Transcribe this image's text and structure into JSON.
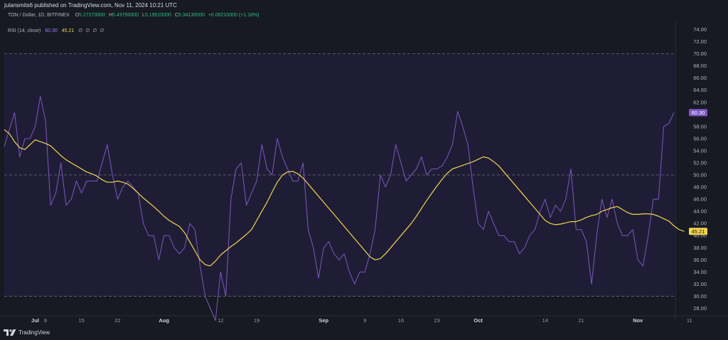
{
  "header": {
    "published": "julansmits6 published on TradingView.com, Nov 11, 2024 10:21 UTC",
    "symbol": "TON / Dollar, 1D, BITFINEX",
    "o_label": "O",
    "o_value": "5.27270000",
    "h_label": "H",
    "h_value": "5.43790000",
    "l_label": "L",
    "l_value": "5.19510000",
    "c_label": "C",
    "c_value": "5.34130000",
    "change": "+0.06210000 (+1.18%)"
  },
  "indicator": {
    "name": "RSI (14, close)",
    "rsi_value": "60.30",
    "ma_value": "45.21",
    "extras": [
      "∅",
      "∅",
      "∅",
      "∅"
    ]
  },
  "footer": {
    "logo_text": "TradingView"
  },
  "colors": {
    "background": "#171a22",
    "band": "#1f1d35",
    "rsi_line": "#7e57c2",
    "ma_line": "#f1d44f",
    "rsi_badge": "#7e57c2",
    "ma_badge": "#f1d44f"
  },
  "chart_data": {
    "type": "line",
    "title": "",
    "xlabel": "",
    "ylabel": "",
    "ylim": [
      27,
      75
    ],
    "yticks": [
      28,
      30,
      32,
      34,
      36,
      38,
      40,
      42,
      44,
      46,
      48,
      50,
      52,
      54,
      56,
      58,
      60,
      62,
      64,
      66,
      68,
      70,
      72,
      74
    ],
    "ytick_labels": [
      "28.00",
      "30.00",
      "32.00",
      "34.00",
      "36.00",
      "38.00",
      "40.00",
      "42.00",
      "44.00",
      "46.00",
      "48.00",
      "50.00",
      "52.00",
      "54.00",
      "56.00",
      "58.00",
      "60.00",
      "62.00",
      "64.00",
      "66.00",
      "68.00",
      "70.00",
      "72.00",
      "74.00"
    ],
    "reference_levels": [
      70,
      50,
      30
    ],
    "band": [
      30,
      70
    ],
    "xticks": [
      {
        "label": "Jul",
        "day": 6,
        "bold": true
      },
      {
        "label": "8",
        "day": 8,
        "bold": false
      },
      {
        "label": "15",
        "day": 15,
        "bold": false
      },
      {
        "label": "22",
        "day": 22,
        "bold": false
      },
      {
        "label": "Aug",
        "day": 31,
        "bold": true
      },
      {
        "label": "12",
        "day": 42,
        "bold": false
      },
      {
        "label": "19",
        "day": 49,
        "bold": false
      },
      {
        "label": "Sep",
        "day": 62,
        "bold": true
      },
      {
        "label": "9",
        "day": 70,
        "bold": false
      },
      {
        "label": "16",
        "day": 77,
        "bold": false
      },
      {
        "label": "23",
        "day": 84,
        "bold": false
      },
      {
        "label": "Oct",
        "day": 92,
        "bold": true
      },
      {
        "label": "14",
        "day": 105,
        "bold": false
      },
      {
        "label": "21",
        "day": 112,
        "bold": false
      },
      {
        "label": "Nov",
        "day": 123,
        "bold": true
      },
      {
        "label": "11",
        "day": 133,
        "bold": false
      }
    ],
    "series": [
      {
        "name": "RSI",
        "values": [
          54.7,
          57.5,
          60.3,
          53,
          56,
          56,
          58,
          63,
          59,
          45,
          47,
          52,
          45,
          46,
          49,
          47,
          49,
          49,
          49,
          52,
          55,
          50,
          46,
          48,
          49,
          48,
          47,
          42,
          40,
          40,
          36,
          40,
          40,
          38,
          37,
          38,
          42,
          41,
          35,
          30,
          28,
          26,
          34,
          30,
          46,
          51,
          52,
          45,
          47,
          49,
          55,
          51,
          50,
          56,
          53,
          51,
          49,
          49,
          52,
          41,
          38,
          33,
          38,
          39,
          37,
          36,
          37,
          34,
          32,
          34,
          34,
          37,
          41,
          50,
          48,
          50,
          55,
          52,
          49,
          50,
          51,
          53,
          50,
          51,
          51,
          51.5,
          53,
          55,
          60.5,
          58,
          55,
          48,
          42,
          41,
          44,
          42,
          40,
          40,
          39,
          39,
          37,
          38,
          40,
          41,
          44,
          46,
          43,
          45,
          44,
          46,
          51,
          41,
          41,
          39,
          32,
          40,
          46,
          43,
          46,
          42,
          40,
          40,
          41,
          36,
          35,
          40,
          46,
          46,
          58,
          58.5,
          60.3
        ],
        "last_label": "60.30"
      },
      {
        "name": "RSI-based MA",
        "values": [
          57.5,
          56.8,
          55.5,
          54.5,
          54.2,
          55.0,
          55.8,
          55.5,
          55.2,
          54.8,
          54.0,
          53.2,
          52.5,
          52.0,
          51.5,
          51.0,
          50.5,
          50.2,
          49.8,
          49.2,
          48.8,
          48.8,
          49.0,
          48.8,
          48.5,
          47.8,
          47.0,
          46.2,
          45.5,
          44.8,
          44.0,
          43.2,
          42.5,
          42.0,
          41.5,
          40.5,
          39.0,
          37.5,
          36.0,
          35.2,
          35.0,
          35.8,
          36.8,
          37.5,
          38.2,
          38.8,
          39.5,
          40.2,
          41.0,
          42.5,
          44.0,
          45.5,
          47.2,
          48.8,
          50.0,
          50.5,
          50.6,
          50.2,
          49.5,
          48.5,
          47.5,
          46.5,
          45.5,
          44.5,
          43.5,
          42.5,
          41.5,
          40.5,
          39.5,
          38.5,
          37.5,
          36.5,
          36.0,
          36.2,
          37.0,
          38.0,
          39.0,
          40.0,
          41.0,
          42.0,
          43.2,
          44.5,
          45.8,
          47.0,
          48.2,
          49.3,
          50.3,
          51.0,
          51.3,
          51.6,
          51.9,
          52.2,
          52.6,
          53.0,
          52.8,
          52.2,
          51.5,
          50.5,
          49.5,
          48.5,
          47.5,
          46.5,
          45.5,
          44.5,
          43.5,
          42.5,
          42.0,
          41.8,
          41.9,
          42.1,
          42.3,
          42.3,
          42.6,
          43.0,
          43.3,
          43.5,
          44.0,
          44.3,
          44.6,
          44.8,
          44.3,
          43.8,
          43.5,
          43.5,
          43.6,
          43.6,
          43.5,
          43.2,
          42.8,
          42.4,
          41.6,
          41.0,
          40.7
        ],
        "last_label": "45.21"
      }
    ]
  }
}
